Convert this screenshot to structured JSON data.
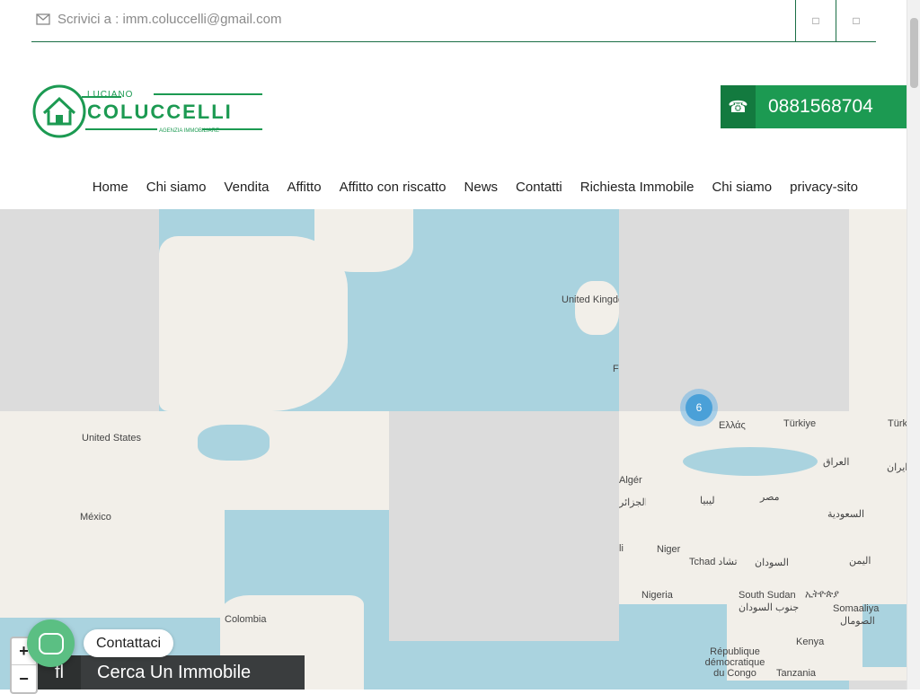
{
  "header": {
    "email_text": "Scrivici a : imm.coluccelli@gmail.com",
    "icons": [
      "envelope-icon",
      "social-icon-1",
      "social-icon-2"
    ]
  },
  "logo": {
    "top_text": "LUCIANO",
    "main_text": "COLUCCELLI",
    "sub_text": "AGENZIA IMMOBILIARE"
  },
  "phone": {
    "number": "0881568704",
    "icon": "phone-icon"
  },
  "nav": {
    "items": [
      "Home",
      "Chi siamo",
      "Vendita",
      "Affitto",
      "Affitto con riscatto",
      "News",
      "Contatti",
      "Richiesta Immobile",
      "Chi siamo",
      "privacy-sito"
    ]
  },
  "map": {
    "labels": [
      "United States",
      "México",
      "Colombia",
      "United Kingdom",
      "Ελλάς",
      "Türkiye",
      "Türk",
      "Algérie",
      "الجزائر",
      "ليبيا",
      "مصر",
      "Niger",
      "Tchad تشاد",
      "السودان",
      "Nigeria",
      "South Sudan",
      "جنوب السودان",
      "ኢትዮጵያ",
      "Somaaliya",
      "الصومال",
      "Kenya",
      "République démocratique du Congo",
      "Tanzania",
      "العراق",
      "السعودية",
      "اليمن",
      "ایران",
      "F",
      "li"
    ],
    "cluster_count": "6",
    "zoom_in": "+",
    "zoom_out": "−"
  },
  "search": {
    "label": "Cerca Un Immobile",
    "icon": "search-toggle-icon"
  },
  "chat": {
    "label": "Contattaci",
    "icon": "chat-icon"
  },
  "colors": {
    "brand_green": "#1c9a52",
    "dark_green": "#137a3f",
    "sea": "#aad3df",
    "land": "#f2efe9"
  }
}
